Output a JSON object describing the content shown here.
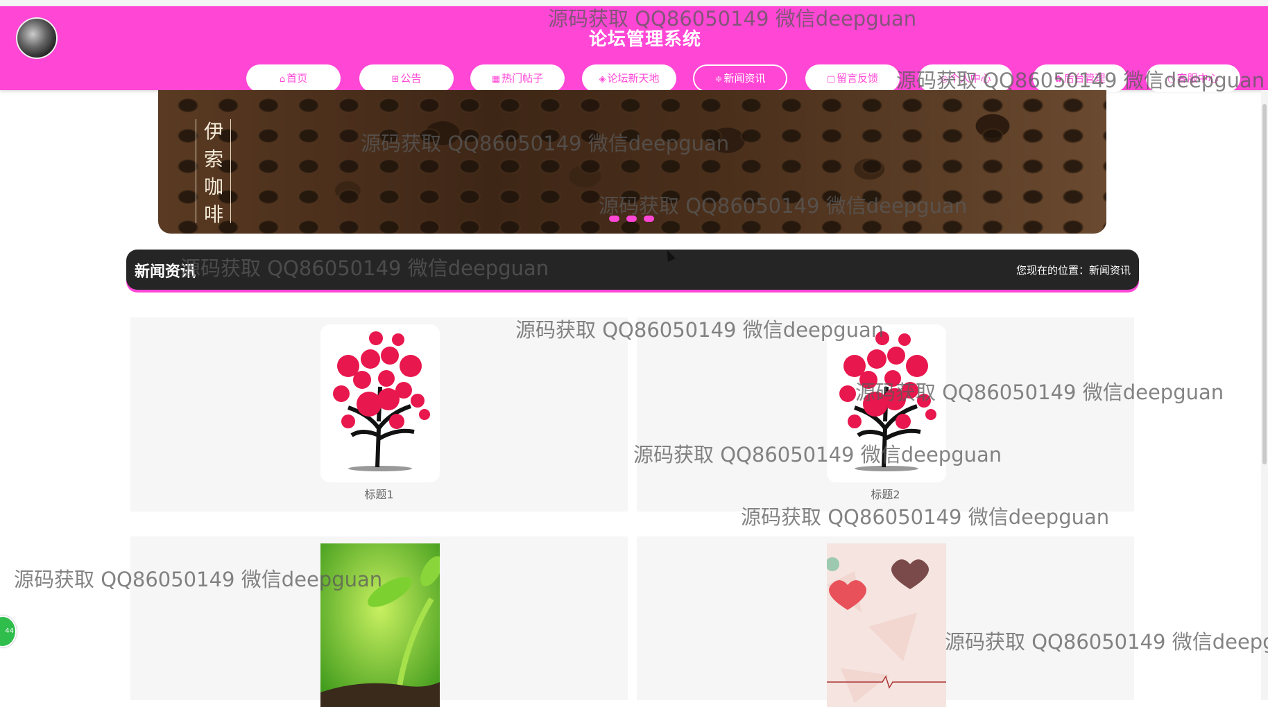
{
  "header": {
    "title": "论坛管理系统",
    "nav": [
      {
        "label": "首页",
        "icon": "home-icon",
        "glyph": "⌂",
        "active": false
      },
      {
        "label": "公告",
        "icon": "book-icon",
        "glyph": "⊞",
        "active": false
      },
      {
        "label": "热门帖子",
        "icon": "grid-icon",
        "glyph": "▦",
        "active": false
      },
      {
        "label": "论坛新天地",
        "icon": "cube-icon",
        "glyph": "◈",
        "active": false
      },
      {
        "label": "新闻资讯",
        "icon": "sliders-icon",
        "glyph": "≑",
        "active": true
      },
      {
        "label": "留言反馈",
        "icon": "note-icon",
        "glyph": "▢",
        "active": false
      },
      {
        "label": "个人中心",
        "icon": "user-icon",
        "glyph": "◎",
        "active": false
      },
      {
        "label": "后台管理",
        "icon": "gear-icon",
        "glyph": "✿",
        "active": false
      },
      {
        "label": "客服中心",
        "icon": "search-icon",
        "glyph": "○",
        "active": false
      }
    ]
  },
  "banner": {
    "caption": "伊索咖啡"
  },
  "section": {
    "title": "新闻资讯",
    "breadcrumb": "您现在的位置：新闻资讯"
  },
  "news": [
    {
      "title": "标题1",
      "image": "heart-tree"
    },
    {
      "title": "标题2",
      "image": "heart-tree"
    },
    {
      "title": "",
      "image": "sprout"
    },
    {
      "title": "",
      "image": "hearts-pattern"
    }
  ],
  "watermark": "源码获取 QQ86050149 微信deepguan",
  "side_badge": "44",
  "colors": {
    "accent": "#ff46d5",
    "dark_bar": "#252525",
    "card_bg": "#f7f6f7"
  }
}
